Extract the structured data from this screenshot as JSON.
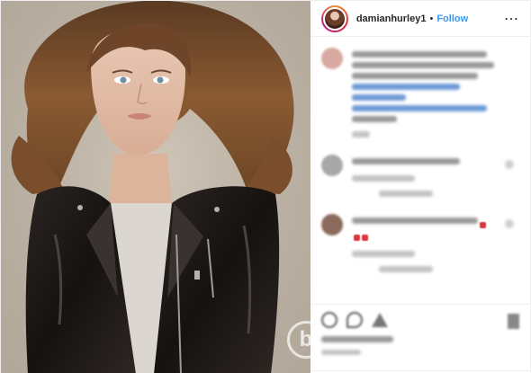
{
  "header": {
    "username": "damianhurley1",
    "separator": "•",
    "follow_label": "Follow",
    "more_icon": "⋯"
  },
  "watermark": {
    "glyph": "b"
  },
  "icons": {
    "like": "heart-icon",
    "comment": "comment-icon",
    "share": "share-icon",
    "save": "bookmark-icon",
    "more": "more-options-icon"
  },
  "colors": {
    "follow": "#3897f0",
    "text": "#262626",
    "border": "#efefef"
  }
}
